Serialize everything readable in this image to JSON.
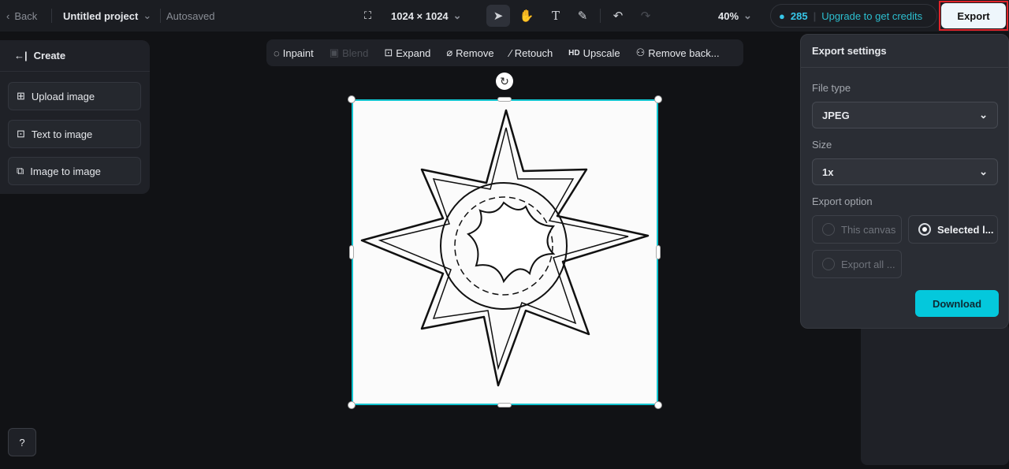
{
  "topbar": {
    "back": "Back",
    "project": "Untitled project",
    "status": "Autosaved",
    "dimensions": "1024 × 1024",
    "zoom": "40%",
    "credits": "285",
    "upgrade": "Upgrade to get credits",
    "export": "Export"
  },
  "left": {
    "title": "Create",
    "items": [
      {
        "label": "Upload image"
      },
      {
        "label": "Text to image"
      },
      {
        "label": "Image to image"
      }
    ]
  },
  "toolbar": {
    "items": [
      {
        "label": "Inpaint",
        "icon": "inpaint-icon"
      },
      {
        "label": "Blend",
        "icon": "blend-icon",
        "disabled": true
      },
      {
        "label": "Expand",
        "icon": "expand-icon"
      },
      {
        "label": "Remove",
        "icon": "eraser-icon"
      },
      {
        "label": "Retouch",
        "icon": "wand-icon"
      },
      {
        "label": "Upscale",
        "icon": "HD"
      },
      {
        "label": "Remove back...",
        "icon": "remove-bg-icon"
      }
    ]
  },
  "export_panel": {
    "title": "Export settings",
    "file_type_label": "File type",
    "file_type": "JPEG",
    "size_label": "Size",
    "size": "1x",
    "option_label": "Export option",
    "options": [
      {
        "label": "This canvas",
        "selected": false
      },
      {
        "label": "Selected l...",
        "selected": true
      },
      {
        "label": "Export all ...",
        "selected": false
      }
    ],
    "download": "Download"
  },
  "colors": {
    "accent": "#04c8dc",
    "selection": "#12c4cf",
    "highlight": "#e0242a"
  }
}
